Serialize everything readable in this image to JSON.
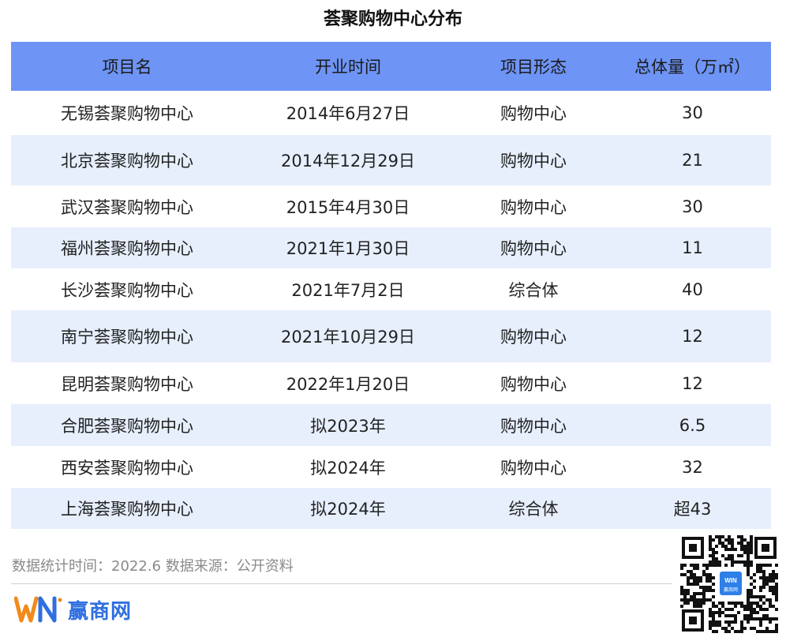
{
  "title": "荟聚购物中心分布",
  "table": {
    "headers": [
      "项目名",
      "开业时间",
      "项目形态",
      "总体量（万㎡）"
    ],
    "rows": [
      [
        "无锡荟聚购物中心",
        "2014年6月27日",
        "购物中心",
        "30"
      ],
      [
        "北京荟聚购物中心",
        "2014年12月29日",
        "购物中心",
        "21"
      ],
      [
        "武汉荟聚购物中心",
        "2015年4月30日",
        "购物中心",
        "30"
      ],
      [
        "福州荟聚购物中心",
        "2021年1月30日",
        "购物中心",
        "11"
      ],
      [
        "长沙荟聚购物中心",
        "2021年7月2日",
        "综合体",
        "40"
      ],
      [
        "南宁荟聚购物中心",
        "2021年10月29日",
        "购物中心",
        "12"
      ],
      [
        "昆明荟聚购物中心",
        "2022年1月20日",
        "购物中心",
        "12"
      ],
      [
        "合肥荟聚购物中心",
        "拟2023年",
        "购物中心",
        "6.5"
      ],
      [
        "西安荟聚购物中心",
        "拟2024年",
        "购物中心",
        "32"
      ],
      [
        "上海荟聚购物中心",
        "拟2024年",
        "综合体",
        "超43"
      ]
    ]
  },
  "footer": {
    "source": "数据统计时间：2022.6 数据来源：公开资料"
  },
  "brand": {
    "logo_mark": "WN",
    "name": "赢商网",
    "qr_badge": "WIN",
    "qr_caption": "赢商网"
  },
  "colors": {
    "header_bg": "#6e94f5",
    "stripe_bg": "#e7effd",
    "brand_blue": "#2f6fe0",
    "brand_orange": "#f28a1a"
  }
}
